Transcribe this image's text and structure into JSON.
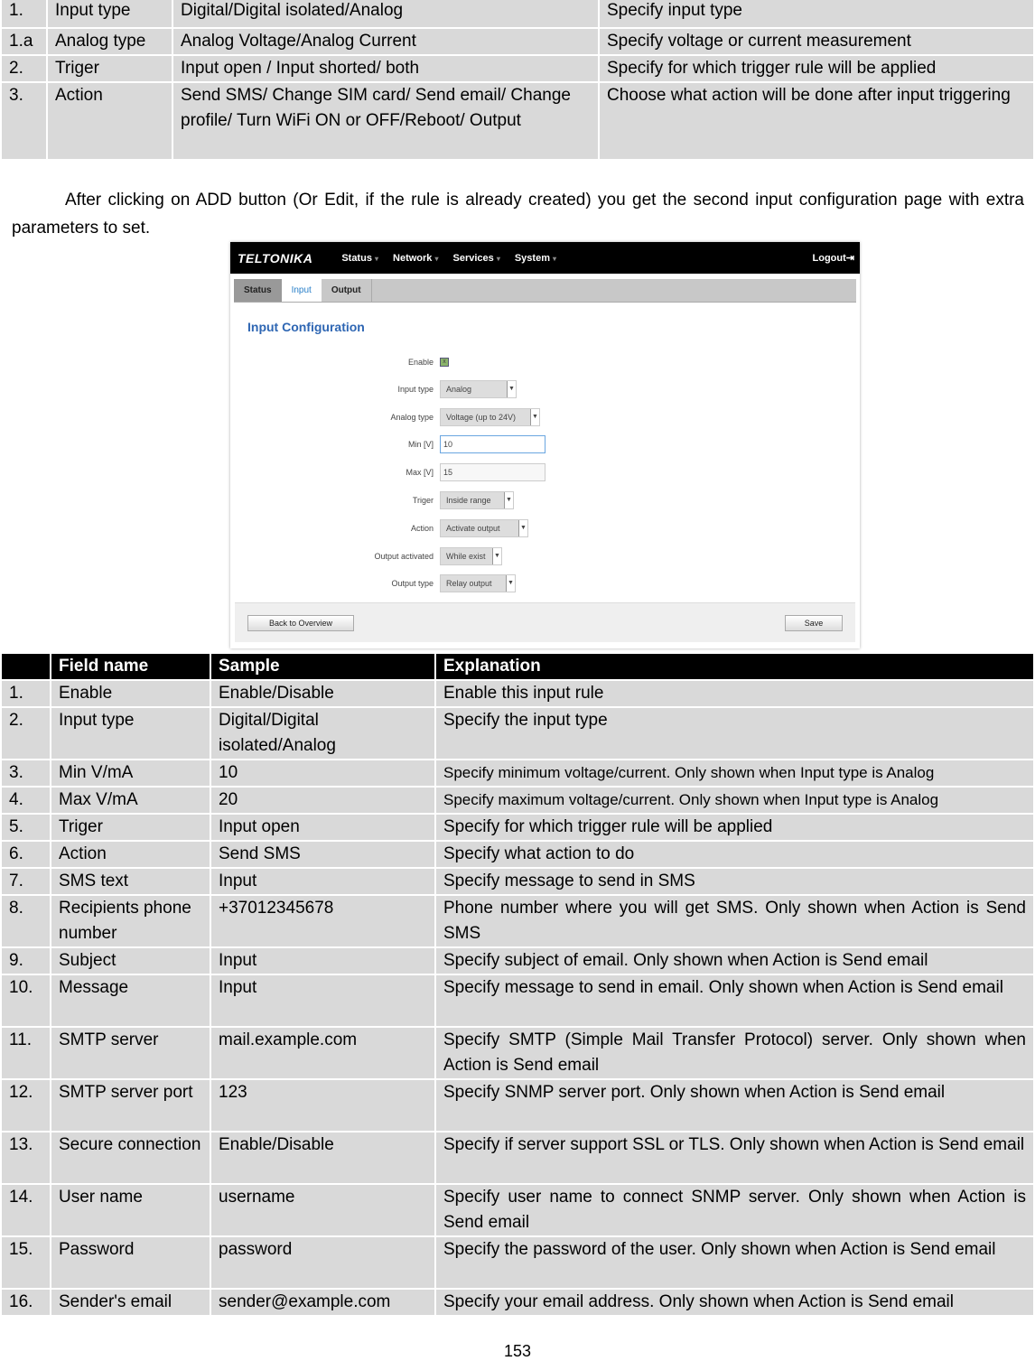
{
  "top_table": [
    [
      "1.",
      "Input type",
      "Digital/Digital isolated/Analog",
      "Specify input type"
    ],
    [
      "1.a",
      "Analog type",
      "Analog Voltage/Analog Current",
      "Specify voltage or current measurement"
    ],
    [
      "2.",
      "Triger",
      "Input open / Input shorted/ both",
      "Specify for which trigger rule will be applied"
    ],
    [
      "3.",
      "Action",
      "Send SMS/ Change SIM card/ Send email/ Change profile/ Turn WiFi ON or OFF/Reboot/ Output",
      "Choose what action will be done after input triggering"
    ]
  ],
  "paragraph": "After clicking on ADD button (Or Edit, if the rule is already created) you get the second input configuration page with extra parameters to set.",
  "screenshot": {
    "logo": "TELTONIKA",
    "menu": [
      "Status",
      "Network",
      "Services",
      "System"
    ],
    "logout": "Logout",
    "tabs": [
      "Status",
      "Input",
      "Output"
    ],
    "active_tab": "Input",
    "title": "Input Configuration",
    "fields": {
      "enable": {
        "label": "Enable",
        "checked": true
      },
      "input_type": {
        "label": "Input type",
        "value": "Analog"
      },
      "analog_type": {
        "label": "Analog type",
        "value": "Voltage (up to 24V)"
      },
      "min": {
        "label": "Min [V]",
        "value": "10"
      },
      "max": {
        "label": "Max [V]",
        "value": "15"
      },
      "triger": {
        "label": "Triger",
        "value": "Inside range"
      },
      "action": {
        "label": "Action",
        "value": "Activate output"
      },
      "output_activated": {
        "label": "Output activated",
        "value": "While exist"
      },
      "output_type": {
        "label": "Output type",
        "value": "Relay output"
      }
    },
    "back_button": "Back to Overview",
    "save_button": "Save"
  },
  "fields_table": {
    "headers": [
      "",
      "Field name",
      "Sample",
      "Explanation"
    ],
    "rows": [
      [
        "1.",
        "Enable",
        "Enable/Disable",
        "Enable this input rule"
      ],
      [
        "2.",
        "Input type",
        "Digital/Digital isolated/Analog",
        "Specify the input type"
      ],
      [
        "3.",
        "Min V/mA",
        "10",
        "Specify minimum voltage/current. Only shown when Input type is Analog"
      ],
      [
        "4.",
        "Max  V/mA",
        "20",
        "Specify maximum voltage/current. Only shown when Input type is Analog"
      ],
      [
        "5.",
        "Triger",
        "Input open",
        "Specify for which trigger rule will be applied"
      ],
      [
        "6.",
        "Action",
        "Send SMS",
        "Specify what action to do"
      ],
      [
        "7.",
        "SMS text",
        "Input",
        "Specify message to send in SMS"
      ],
      [
        "8.",
        "Recipients phone number",
        "+37012345678",
        "Phone number where you will get SMS. Only shown when Action is Send SMS"
      ],
      [
        "9.",
        "Subject",
        "Input",
        "Specify subject of email. Only shown when Action is Send email"
      ],
      [
        "10.",
        "Message",
        "Input",
        "Specify message to send in email. Only shown when Action is Send email"
      ],
      [
        "11.",
        "SMTP server",
        "mail.example.com",
        "Specify SMTP (Simple Mail Transfer Protocol) server. Only shown when Action is Send email"
      ],
      [
        "12.",
        "SMTP server port",
        "123",
        "Specify SNMP server port. Only shown when Action is Send email"
      ],
      [
        "13.",
        "Secure connection",
        "Enable/Disable",
        "Specify if server support SSL or TLS. Only shown when Action is Send email"
      ],
      [
        "14.",
        "User name",
        "username",
        "Specify user name to connect SNMP server. Only shown when Action is Send email"
      ],
      [
        "15.",
        "Password",
        "password",
        "Specify the password of the user. Only shown when Action is Send email"
      ],
      [
        "16.",
        "Sender's email",
        "sender@example.com",
        "Specify your email address. Only shown when Action is Send email"
      ]
    ]
  },
  "page_number": "153"
}
